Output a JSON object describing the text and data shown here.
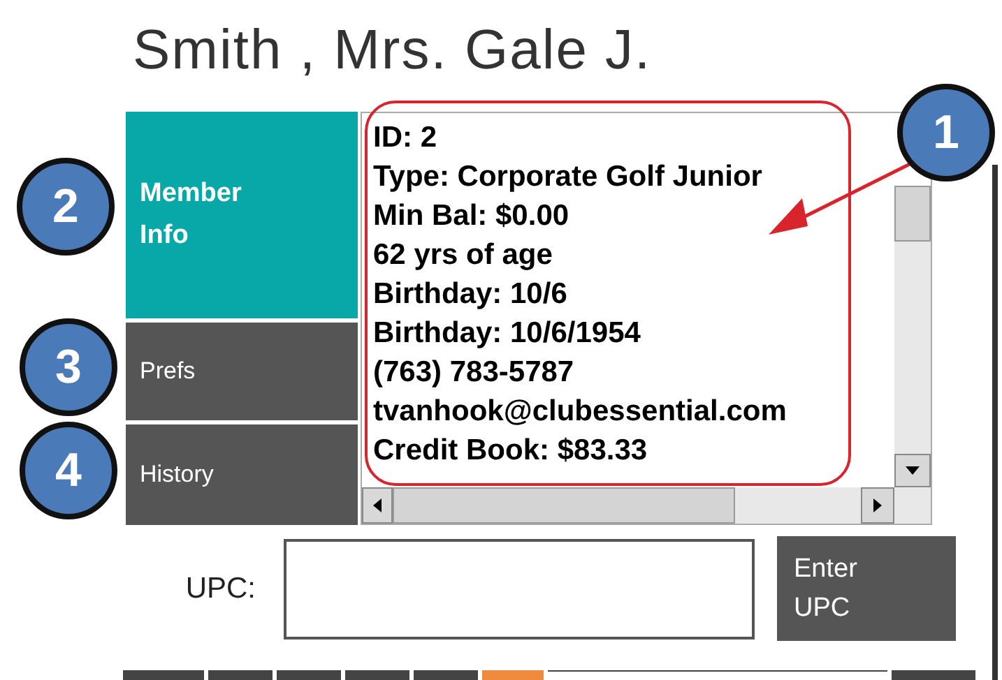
{
  "member_name": "Smith , Mrs. Gale J.",
  "tabs": [
    {
      "label": "Member Info",
      "selected": true
    },
    {
      "label": "Prefs",
      "selected": false
    },
    {
      "label": "History",
      "selected": false
    }
  ],
  "info_lines": [
    "ID: 2",
    "Type: Corporate Golf Junior",
    "Min Bal: $0.00",
    "62 yrs of age",
    "Birthday: 10/6",
    "Birthday: 10/6/1954",
    "(763) 783-5787",
    "tvanhook@clubessential.com",
    "Credit Book: $83.33"
  ],
  "upc": {
    "label": "UPC:",
    "button": "Enter UPC"
  },
  "callouts": [
    "1",
    "2",
    "3",
    "4"
  ]
}
